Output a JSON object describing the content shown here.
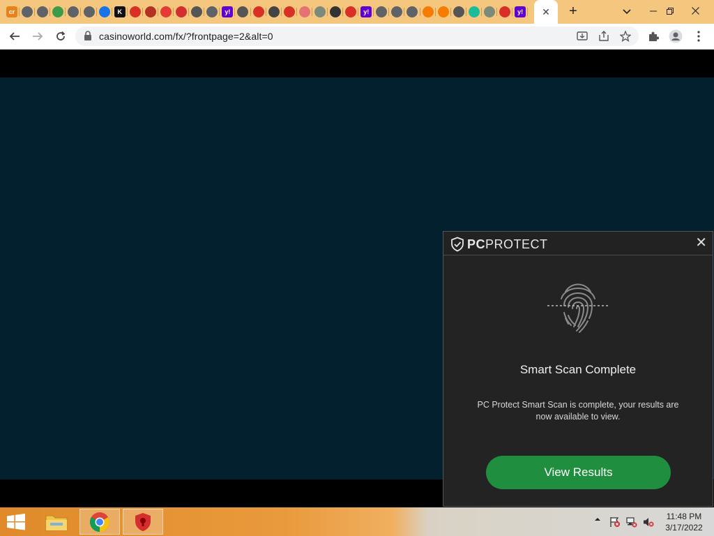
{
  "browser": {
    "tabs": [
      {
        "icon": "cr-icon",
        "color": "#e8831c",
        "text": "cr"
      },
      {
        "icon": "globe-icon",
        "color": "#5f6368",
        "text": ""
      },
      {
        "icon": "globe-icon",
        "color": "#5f6368",
        "text": ""
      },
      {
        "icon": "leaf-icon",
        "color": "#3c9a48",
        "text": ""
      },
      {
        "icon": "globe-icon",
        "color": "#5f6368",
        "text": ""
      },
      {
        "icon": "globe-icon",
        "color": "#5f6368",
        "text": ""
      },
      {
        "icon": "arch-icon",
        "color": "#1a73e8",
        "text": ""
      },
      {
        "icon": "k-icon",
        "color": "#111111",
        "text": "K"
      },
      {
        "icon": "shield-red-icon",
        "color": "#d93025",
        "text": ""
      },
      {
        "icon": "bird-icon",
        "color": "#b23121",
        "text": ""
      },
      {
        "icon": "red-square-icon",
        "color": "#e53935",
        "text": ""
      },
      {
        "icon": "check-red-icon",
        "color": "#d32f2f",
        "text": ""
      },
      {
        "icon": "download-icon",
        "color": "#555555",
        "text": ""
      },
      {
        "icon": "globe-icon",
        "color": "#5f6368",
        "text": ""
      },
      {
        "icon": "yahoo-icon",
        "color": "#6001d2",
        "text": "y!"
      },
      {
        "icon": "search-icon",
        "color": "#555555",
        "text": ""
      },
      {
        "icon": "shield-red-icon",
        "color": "#d93025",
        "text": ""
      },
      {
        "icon": "power-icon",
        "color": "#444444",
        "text": ""
      },
      {
        "icon": "shield-red-icon",
        "color": "#d93025",
        "text": ""
      },
      {
        "icon": "rainbow-icon",
        "color": "#e57373",
        "text": ""
      },
      {
        "icon": "shield-check-icon",
        "color": "#7c8a7a",
        "text": ""
      },
      {
        "icon": "avatar-icon",
        "color": "#333333",
        "text": ""
      },
      {
        "icon": "shield-red-icon",
        "color": "#d93025",
        "text": ""
      },
      {
        "icon": "yahoo-icon",
        "color": "#6001d2",
        "text": "y!"
      },
      {
        "icon": "globe-icon",
        "color": "#5f6368",
        "text": ""
      },
      {
        "icon": "globe-icon",
        "color": "#5f6368",
        "text": ""
      },
      {
        "icon": "globe-icon",
        "color": "#5f6368",
        "text": ""
      },
      {
        "icon": "warning-icon",
        "color": "#f57c00",
        "text": ""
      },
      {
        "icon": "warning-icon",
        "color": "#f57c00",
        "text": ""
      },
      {
        "icon": "search-icon",
        "color": "#555555",
        "text": ""
      },
      {
        "icon": "diamond-icon",
        "color": "#1abc9c",
        "text": ""
      },
      {
        "icon": "shield-check-icon",
        "color": "#7c8a7a",
        "text": ""
      },
      {
        "icon": "shield-red-icon",
        "color": "#d93025",
        "text": ""
      },
      {
        "icon": "yahoo-icon",
        "color": "#6001d2",
        "text": "y!"
      }
    ],
    "close_tab": "✕",
    "new_tab": "+",
    "url": "casinoworld.com/fx/?frontpage=2&alt=0"
  },
  "popup": {
    "brand_bold": "PC",
    "brand_rest": "PROTECT",
    "close": "✕",
    "title": "Smart Scan Complete",
    "description": "PC Protect Smart Scan is complete, your results are now available to view.",
    "button": "View Results",
    "accent": "#1f8f3f"
  },
  "taskbar": {
    "time": "11:48 PM",
    "date": "3/17/2022"
  }
}
